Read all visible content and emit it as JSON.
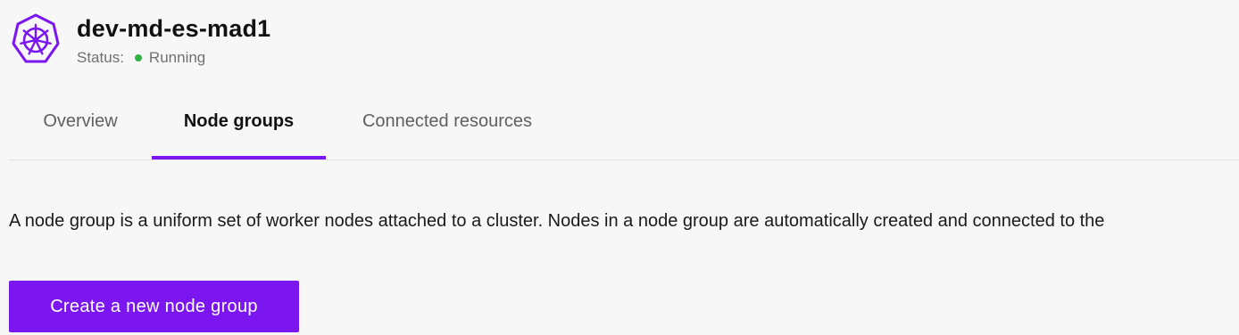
{
  "cluster": {
    "name": "dev-md-es-mad1",
    "status_label": "Status:",
    "status_value": "Running",
    "icon": "kubernetes-icon"
  },
  "tabs": [
    {
      "label": "Overview",
      "active": false
    },
    {
      "label": "Node groups",
      "active": true
    },
    {
      "label": "Connected resources",
      "active": false
    }
  ],
  "main": {
    "description": "A node group is a uniform set of worker nodes attached to a cluster. Nodes in a node group are automatically created and connected to the",
    "create_button_label": "Create a new node group"
  },
  "colors": {
    "accent": "#7b16f0",
    "status_running": "#2fb344"
  }
}
